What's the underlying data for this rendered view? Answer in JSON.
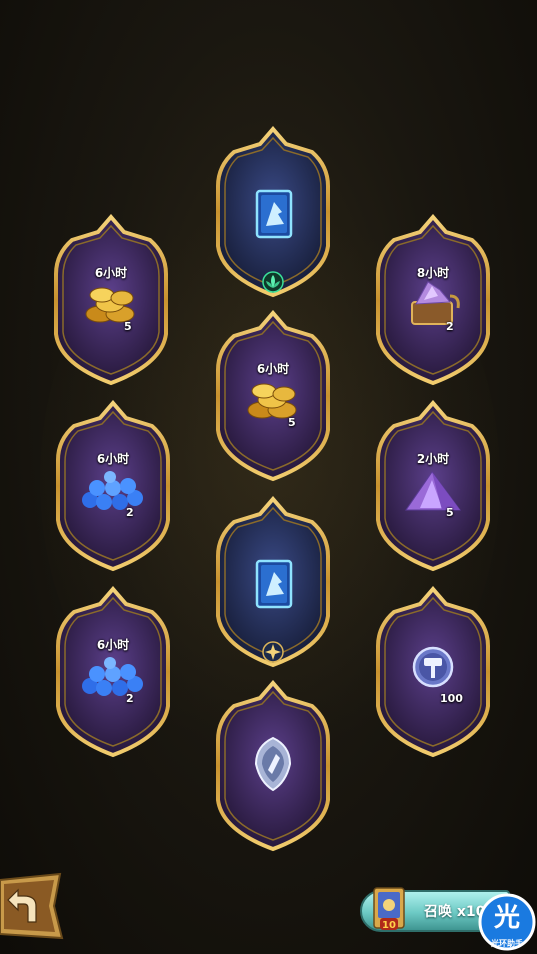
{
  "tiles": [
    {
      "id": "t1",
      "timer": "",
      "count": "",
      "item": "hero-card",
      "badge": "leaf-badge"
    },
    {
      "id": "t2",
      "timer": "6小时",
      "count": "5",
      "item": "gold-coins"
    },
    {
      "id": "t3",
      "timer": "8小时",
      "count": "2",
      "item": "dust-chest"
    },
    {
      "id": "t4",
      "timer": "6小时",
      "count": "5",
      "item": "gold-coins"
    },
    {
      "id": "t5",
      "timer": "6小时",
      "count": "2",
      "item": "blue-orbs"
    },
    {
      "id": "t6",
      "timer": "2小时",
      "count": "5",
      "item": "purple-dust"
    },
    {
      "id": "t7",
      "timer": "",
      "count": "",
      "item": "hero-card",
      "badge": "star-badge"
    },
    {
      "id": "t8",
      "timer": "6小时",
      "count": "2",
      "item": "blue-orbs"
    },
    {
      "id": "t9",
      "timer": "",
      "count": "100",
      "item": "hammer-coin"
    },
    {
      "id": "t10",
      "timer": "",
      "count": "",
      "item": "shield-emblem"
    }
  ],
  "summon": {
    "label": "召唤 x10",
    "card_number": "10"
  },
  "helper": {
    "glyph": "光",
    "label": "光环助手"
  },
  "colors": {
    "frame_gold": "#d9a84a",
    "tile_purple": "#3b2a5c",
    "tile_blue": "#23305a"
  }
}
